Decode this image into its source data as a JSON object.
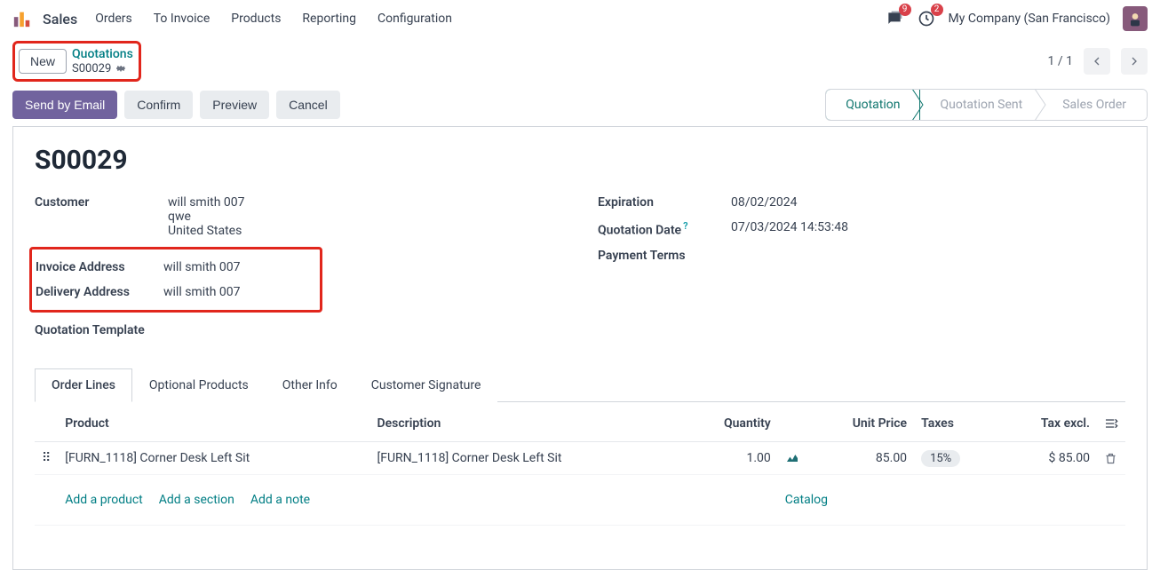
{
  "navbar": {
    "app_name": "Sales",
    "menu": [
      "Orders",
      "To Invoice",
      "Products",
      "Reporting",
      "Configuration"
    ],
    "messages_badge": "9",
    "activities_badge": "2",
    "company": "My Company (San Francisco)"
  },
  "breadcrumb": {
    "new_label": "New",
    "parent": "Quotations",
    "current": "S00029"
  },
  "pager": {
    "text": "1 / 1"
  },
  "actions": {
    "send_email": "Send by Email",
    "confirm": "Confirm",
    "preview": "Preview",
    "cancel": "Cancel"
  },
  "status": {
    "quotation": "Quotation",
    "quotation_sent": "Quotation Sent",
    "sales_order": "Sales Order"
  },
  "doc": {
    "title": "S00029",
    "customer_label": "Customer",
    "customer_name": "will smith 007",
    "customer_line2": "qwe",
    "customer_country": "United States",
    "invoice_addr_label": "Invoice Address",
    "invoice_addr_value": "will smith 007",
    "delivery_addr_label": "Delivery Address",
    "delivery_addr_value": "will smith 007",
    "template_label": "Quotation Template",
    "expiration_label": "Expiration",
    "expiration_value": "08/02/2024",
    "quotation_date_label": "Quotation Date",
    "quotation_date_value": "07/03/2024 14:53:48",
    "payment_terms_label": "Payment Terms"
  },
  "tabs": {
    "order_lines": "Order Lines",
    "optional": "Optional Products",
    "other": "Other Info",
    "signature": "Customer Signature"
  },
  "table": {
    "headers": {
      "product": "Product",
      "description": "Description",
      "quantity": "Quantity",
      "unit_price": "Unit Price",
      "taxes": "Taxes",
      "tax_excl": "Tax excl."
    },
    "rows": [
      {
        "product": "[FURN_1118] Corner Desk Left Sit",
        "description": "[FURN_1118] Corner Desk Left Sit",
        "quantity": "1.00",
        "unit_price": "85.00",
        "taxes": "15%",
        "tax_excl": "$ 85.00"
      }
    ],
    "add_product": "Add a product",
    "add_section": "Add a section",
    "add_note": "Add a note",
    "catalog": "Catalog"
  }
}
